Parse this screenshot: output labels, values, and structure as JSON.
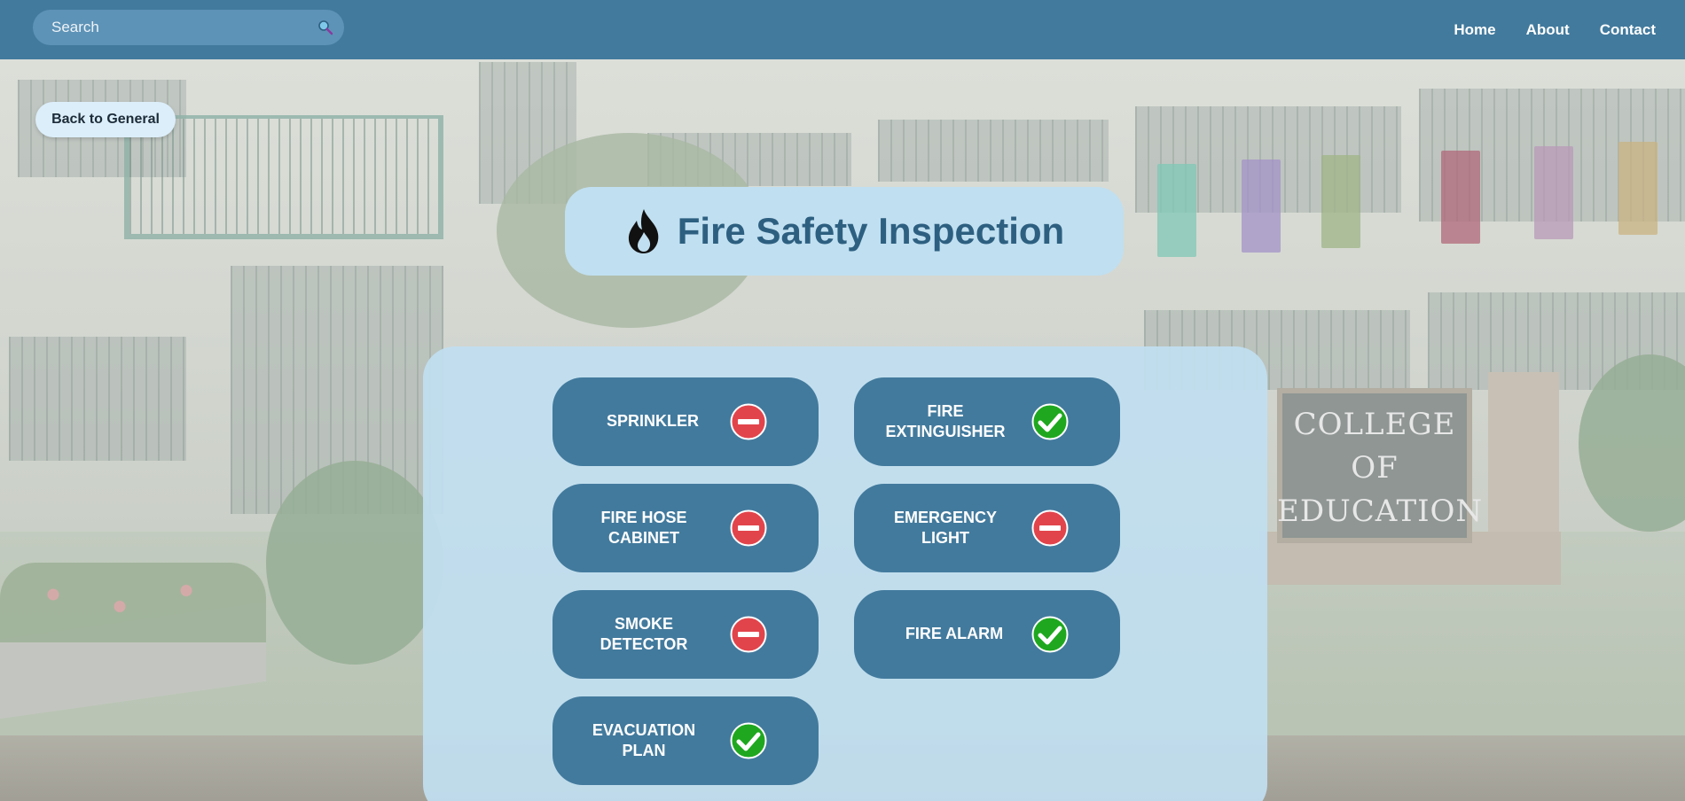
{
  "search": {
    "placeholder": "Search"
  },
  "nav": {
    "home": "Home",
    "about": "About",
    "contact": "Contact"
  },
  "back_button": "Back to General",
  "title": "Fire Safety Inspection",
  "background_sign": [
    "COLLEGE",
    "OF",
    "EDUCATION"
  ],
  "colors": {
    "topbar": "#427a9d",
    "item_bg": "#427a9d",
    "panel_bg": "#c1dff0",
    "title_text": "#2d5f80",
    "ok": "#1fa81f",
    "fail": "#e2444c"
  },
  "items": [
    {
      "label": "SPRINKLER",
      "status": "fail",
      "icon": "no-entry-icon"
    },
    {
      "label": "FIRE EXTINGUISHER",
      "status": "ok",
      "icon": "check-icon"
    },
    {
      "label": "FIRE HOSE CABINET",
      "status": "fail",
      "icon": "no-entry-icon"
    },
    {
      "label": "EMERGENCY LIGHT",
      "status": "fail",
      "icon": "no-entry-icon"
    },
    {
      "label": "SMOKE DETECTOR",
      "status": "fail",
      "icon": "no-entry-icon"
    },
    {
      "label": "FIRE ALARM",
      "status": "ok",
      "icon": "check-icon"
    },
    {
      "label": "EVACUATION PLAN",
      "status": "ok",
      "icon": "check-icon"
    }
  ]
}
